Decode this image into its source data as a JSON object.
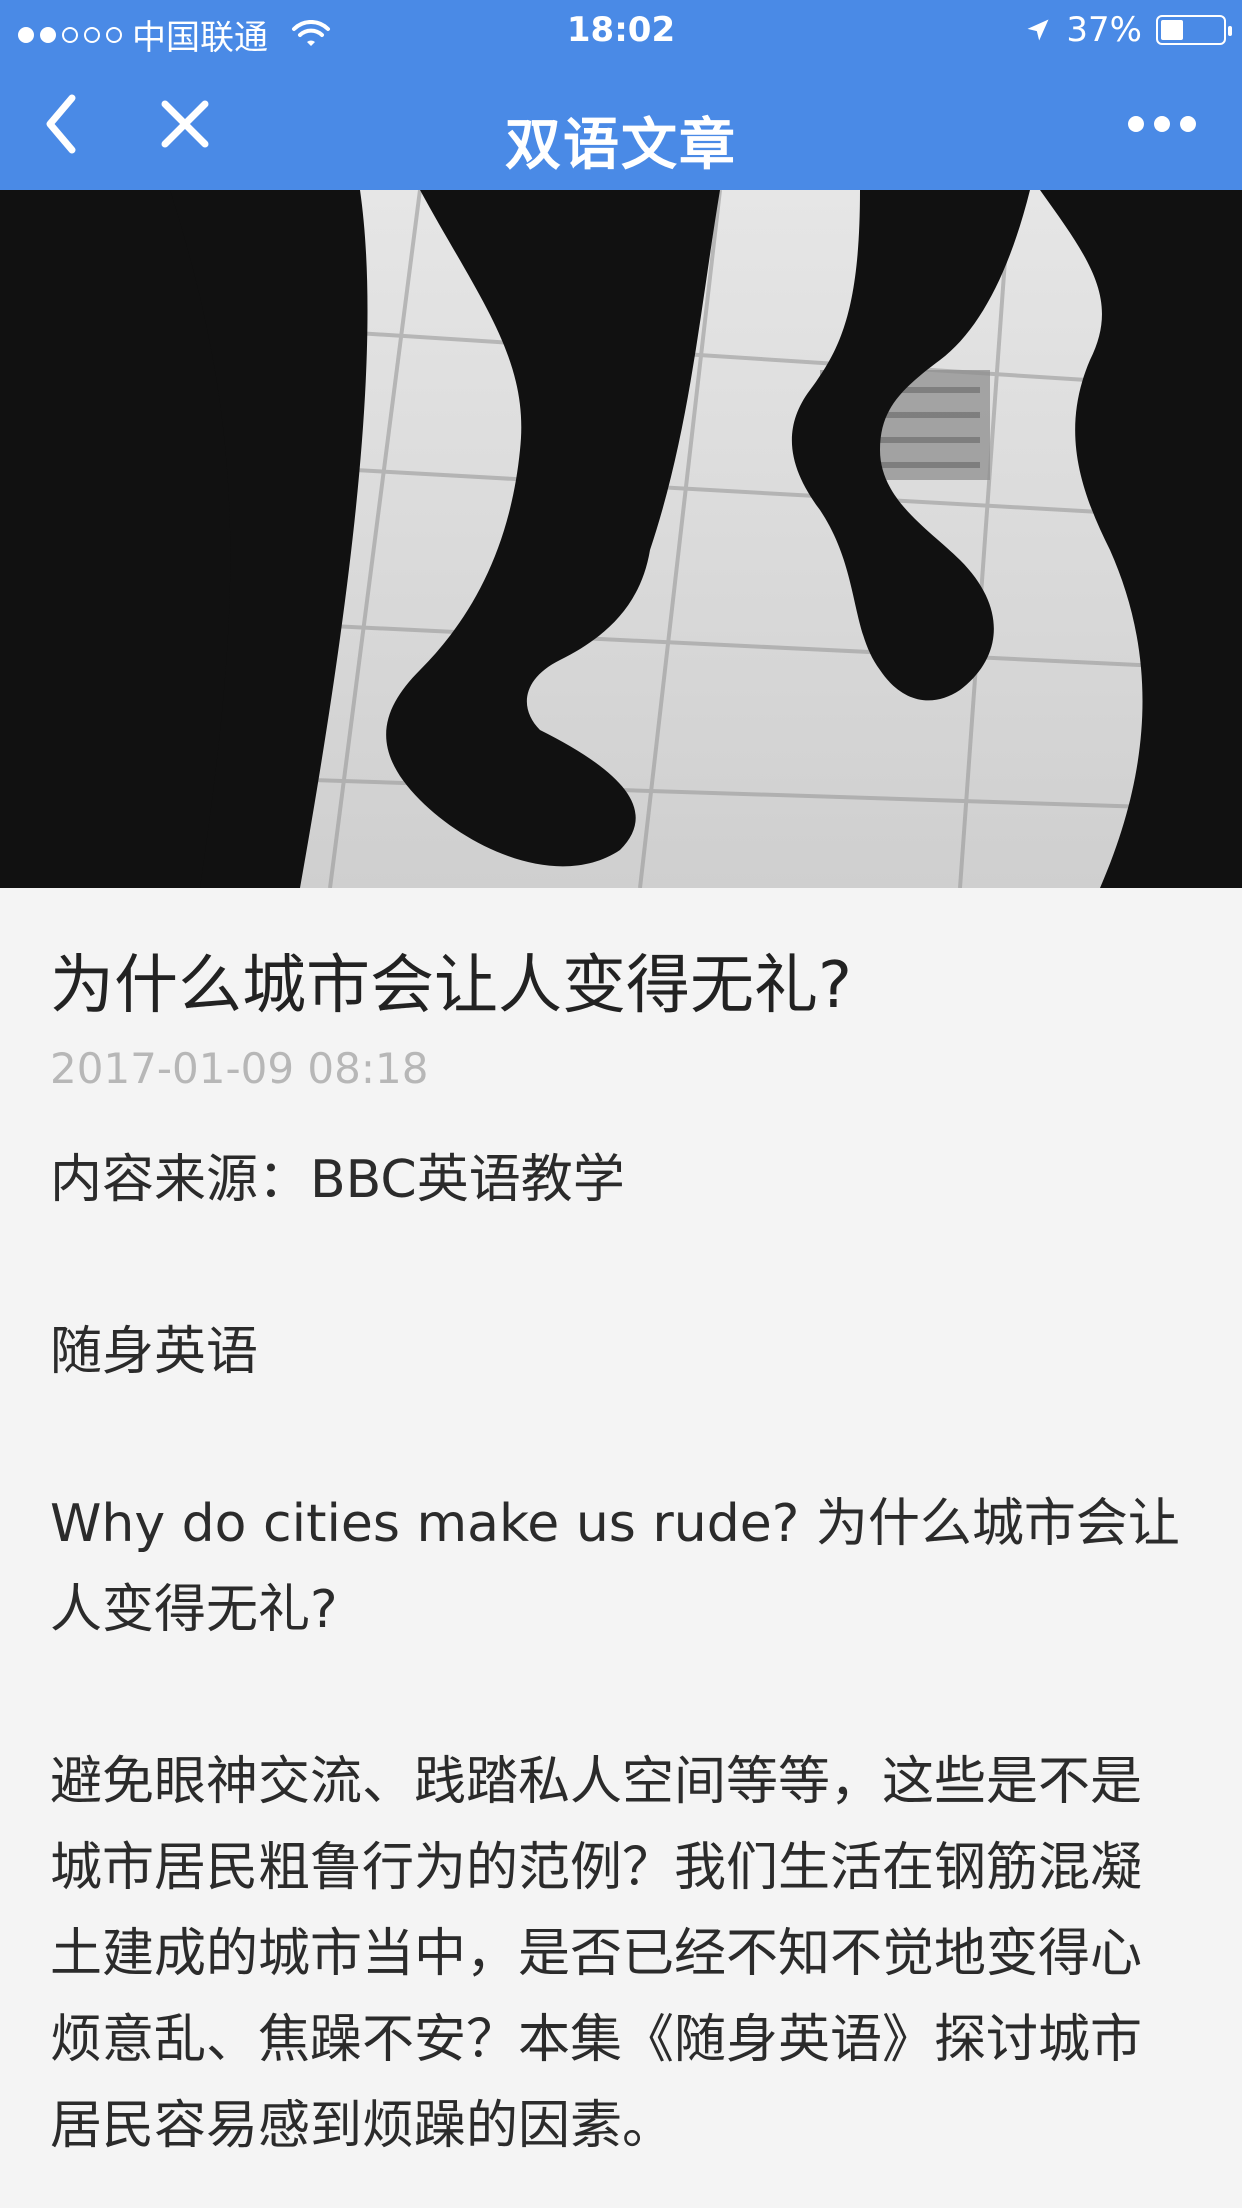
{
  "status_bar": {
    "carrier": "中国联通",
    "time": "18:02",
    "battery_percent": "37%",
    "battery_level": 0.37
  },
  "nav": {
    "title": "双语文章"
  },
  "article": {
    "title": "为什么城市会让人变得无礼?",
    "datetime": "2017-01-09 08:18",
    "source": "内容来源：BBC英语教学",
    "section": "随身英语",
    "headline_bilingual": "Why do cities make us rude? 为什么城市会让人变得无礼?",
    "summary": "避免眼神交流、践踏私人空间等等，这些是不是城市居民粗鲁行为的范例？我们生活在钢筋混凝土建成的城市当中，是否已经不知不觉地变得心烦意乱、焦躁不安？本集《随身英语》探讨城市居民容易感到烦躁的因素。"
  },
  "icons": {
    "back": "chevron-left-icon",
    "close": "close-icon",
    "more": "more-dots-icon",
    "wifi": "wifi-icon",
    "location": "location-arrow-icon",
    "battery": "battery-icon"
  },
  "colors": {
    "header": "#4a8ae6",
    "background": "#f4f4f4",
    "meta": "#b7b7b7"
  }
}
